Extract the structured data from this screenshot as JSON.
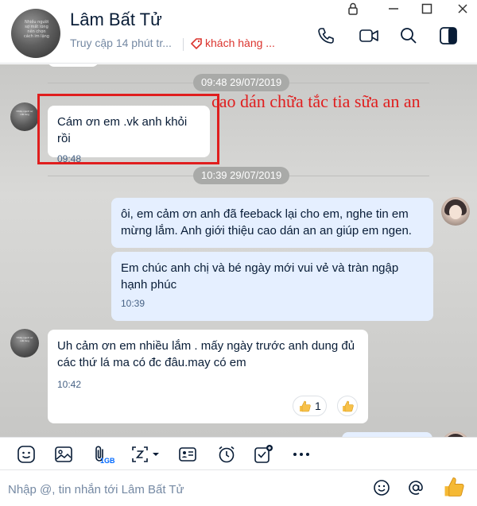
{
  "header": {
    "name": "Lâm Bất Tử",
    "status": "Truy cập 14 phút tr...",
    "tag": "khách hàng ...",
    "avatar_text": "Nhiều người sợ mất lòng nên chọn cách im lặng"
  },
  "messages": [
    {
      "type": "date",
      "text": "09:48 29/07/2019"
    },
    {
      "type": "incoming",
      "text": "Cám ơn em .vk anh khỏi rồi",
      "time": "09:48"
    },
    {
      "type": "date",
      "text": "10:39 29/07/2019"
    },
    {
      "type": "outgoing",
      "text": "ôi, em cảm ơn anh đã feeback lại cho em, nghe tin em mừng lắm. Anh giới thiệu cao dán an an giúp em ngen."
    },
    {
      "type": "outgoing",
      "text": "Em chúc anh chị và bé  ngày mới vui vẻ và tràn ngập hạnh phúc",
      "time": "10:39"
    },
    {
      "type": "incoming",
      "text": "Uh cảm ơn em nhiều lắm . mấy ngày trước anh dung đủ các thứ lá ma có đc đâu.may có em",
      "time": "10:42",
      "reaction_count": "1"
    }
  ],
  "overlay_caption": "cao dán chữa tắc tia sữa an an",
  "toolbar": {
    "file_size": "1GB",
    "icons": [
      "sticker-icon",
      "image-icon",
      "attachment-icon",
      "screenshot-icon",
      "contact-card-icon",
      "reminder-icon",
      "task-icon",
      "more-icon"
    ]
  },
  "composer": {
    "placeholder": "Nhập @, tin nhắn tới Lâm Bất Tử"
  },
  "colors": {
    "accent": "#0068ff",
    "highlight": "#e01e1e",
    "incoming_bubble": "#ffffff",
    "outgoing_bubble": "#e5efff"
  }
}
